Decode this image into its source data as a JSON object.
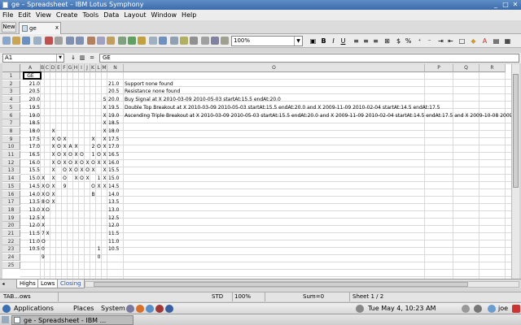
{
  "window": {
    "title": "ge – Spreadsheet – IBM Lotus Symphony"
  },
  "menu": [
    "File",
    "Edit",
    "View",
    "Create",
    "Tools",
    "Data",
    "Layout",
    "Window",
    "Help"
  ],
  "tabs": {
    "new_label": "New",
    "doc_tab": "ge"
  },
  "toolbar": {
    "zoom": "100%"
  },
  "formula": {
    "cell_ref": "A1",
    "content": "GE"
  },
  "columns": [
    "A",
    "B",
    "C",
    "D",
    "E",
    "F",
    "G",
    "H",
    "I",
    "J",
    "K",
    "L",
    "M",
    "N",
    "O",
    "P",
    "Q",
    "R"
  ],
  "rows": [
    "1",
    "2",
    "3",
    "4",
    "5",
    "6",
    "7",
    "8",
    "9",
    "10",
    "11",
    "12",
    "13",
    "14",
    "15",
    "16",
    "17",
    "18",
    "19",
    "20",
    "21",
    "22",
    "23",
    "24",
    "25"
  ],
  "cells": {
    "A1": "GE",
    "prices": [
      "21.0",
      "20.5",
      "20.0",
      "19.5",
      "19.0",
      "18.5",
      "18.0",
      "17.5",
      "17.0",
      "16.5",
      "16.0",
      "15.5",
      "15.0",
      "14.5",
      "14.0",
      "13.5",
      "13.0",
      "12.5",
      "12.0",
      "11.5",
      "11.0",
      "10.5"
    ],
    "n_prices": [
      "21.0",
      "20.5",
      "20.0",
      "19.5",
      "19.0",
      "18.5",
      "18.0",
      "17.5",
      "17.0",
      "16.5",
      "16.0",
      "15.5",
      "15.0",
      "14.5",
      "14.0",
      "13.5",
      "13.0",
      "12.5",
      "12.0",
      "11.5",
      "11.0",
      "10.5"
    ],
    "m_col": [
      "",
      "",
      "S",
      "X",
      "X",
      "X",
      "X",
      "X",
      "X",
      "X",
      "X",
      "X",
      "X",
      "X",
      "",
      "",
      "",
      "",
      "",
      "",
      "",
      ""
    ],
    "grid_rows": [
      [
        "",
        "",
        "",
        "",
        "",
        "",
        "",
        "",
        "",
        "",
        ""
      ],
      [
        "",
        "",
        "",
        "",
        "",
        "",
        "",
        "",
        "",
        "",
        ""
      ],
      [
        "",
        "",
        "",
        "",
        "",
        "",
        "",
        "",
        "",
        "",
        ""
      ],
      [
        "",
        "",
        "",
        "",
        "",
        "",
        "",
        "",
        "",
        "",
        ""
      ],
      [
        "",
        "",
        "",
        "",
        "",
        "",
        "",
        "",
        "",
        "",
        ""
      ],
      [
        "",
        "",
        "",
        "",
        "",
        "",
        "",
        "",
        "",
        "",
        ""
      ],
      [
        "",
        "",
        "X",
        "",
        "",
        "",
        "",
        "",
        "",
        "",
        ""
      ],
      [
        "",
        "",
        "X",
        "O",
        "X",
        "",
        "",
        "",
        "",
        "X",
        ""
      ],
      [
        "",
        "",
        "X",
        "O",
        "X",
        "A",
        "X",
        "",
        "",
        "2",
        "O"
      ],
      [
        "",
        "",
        "X",
        "O",
        "X",
        "O",
        "X",
        "O",
        "",
        "1",
        "O"
      ],
      [
        "",
        "",
        "X",
        "O",
        "X",
        "O",
        "X",
        "O",
        "X",
        "O",
        "X"
      ],
      [
        "",
        "",
        "X",
        "",
        "O",
        "X",
        "O",
        "X",
        "O",
        "X",
        ""
      ],
      [
        "X",
        "",
        "X",
        "",
        "O",
        "",
        "X",
        "O",
        "X",
        "",
        "1"
      ],
      [
        "X",
        "O",
        "X",
        "",
        "9",
        "",
        "",
        "",
        "",
        "O",
        "X"
      ],
      [
        "X",
        "O",
        "X",
        "",
        "",
        "",
        "",
        "",
        "",
        "B",
        ""
      ],
      [
        "8",
        "O",
        "X",
        "",
        "",
        "",
        "",
        "",
        "",
        "",
        ""
      ],
      [
        "X",
        "O",
        "",
        "",
        "",
        "",
        "",
        "",
        "",
        "",
        ""
      ],
      [
        "X",
        "",
        "",
        "",
        "",
        "",
        "",
        "",
        "",
        "",
        ""
      ],
      [
        "X",
        "",
        "",
        "",
        "",
        "",
        "",
        "",
        "",
        "",
        ""
      ],
      [
        "7",
        "X",
        "",
        "",
        "",
        "",
        "",
        "",
        "",
        "",
        ""
      ],
      [
        "O",
        "",
        "",
        "",
        "",
        "",
        "",
        "",
        "",
        "",
        ""
      ],
      [
        "",
        "",
        "",
        "",
        "",
        "",
        "",
        "",
        "",
        "",
        ""
      ]
    ],
    "r23": {
      "B": "0",
      "L": "1"
    },
    "r24": {
      "B": "9",
      "L": "0"
    },
    "notes": [
      "Support none found",
      "Resistance none found",
      "Buy Signal at X 2010-03-09 2010-05-03 startAt:15.5 endAt:20.0",
      "Double Top Breakout at X 2010-03-09 2010-05-03 startAt:15.5 endAt:20.0 and X 2009-11-09 2010-02-04 startAt:14.5 endAt:17.5",
      "Ascending Triple Breakout at X 2010-03-09 2010-05-03 startAt:15.5 endAt:20.0 and X 2009-11-09 2010-02-04 startAt:14.5 endAt:17.5 and X 2009-10-08 2009-10-1"
    ]
  },
  "sheets": {
    "tabs": [
      "Highs",
      "Lows",
      "Closing"
    ],
    "active": "Highs_Lows"
  },
  "status": {
    "sheetname": "TAB...ows",
    "mode": "STD",
    "zoom": "100%",
    "sum": "Sum=0",
    "sheet": "Sheet 1 / 2"
  },
  "panel": {
    "applications": "Applications",
    "places": "Places",
    "system": "System",
    "clock": "Tue May  4, 10:23 AM",
    "user": "joe"
  },
  "taskbar": {
    "task": "ge - Spreadsheet - IBM ..."
  }
}
